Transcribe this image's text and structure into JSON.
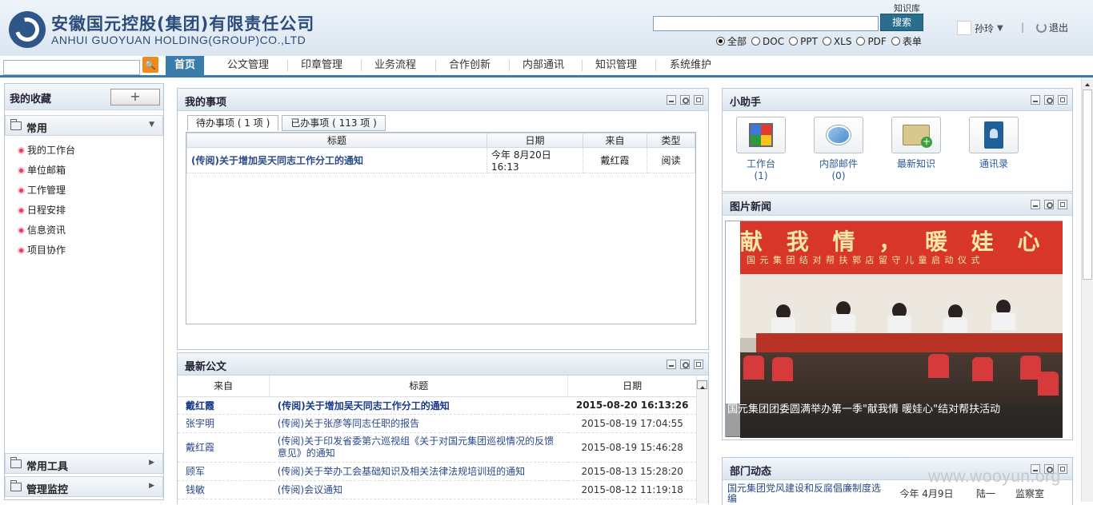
{
  "header": {
    "company_cn": "安徽国元控股(集团)有限责任公司",
    "company_en": "ANHUI GUOYUAN HOLDING(GROUP)CO.,LTD"
  },
  "knowledge": {
    "label": "知识库",
    "search_value": "",
    "search_button": "搜索",
    "filters": [
      {
        "label": "全部",
        "selected": true
      },
      {
        "label": "DOC",
        "selected": false
      },
      {
        "label": "PPT",
        "selected": false
      },
      {
        "label": "XLS",
        "selected": false
      },
      {
        "label": "PDF",
        "selected": false
      },
      {
        "label": "表单",
        "selected": false
      }
    ]
  },
  "user": {
    "name": "孙玲",
    "separator": "|",
    "logout": "退出"
  },
  "nav": {
    "items": [
      "首页",
      "公文管理",
      "印章管理",
      "业务流程",
      "合作创新",
      "内部通讯",
      "知识管理",
      "系统维护"
    ],
    "active_index": 0
  },
  "left": {
    "favorites_title": "我的收藏",
    "add_label": "+",
    "group_common": "常用",
    "items": [
      "我的工作台",
      "单位邮箱",
      "工作管理",
      "日程安排",
      "信息资讯",
      "项目协作"
    ],
    "group_tools": "常用工具",
    "group_monitor": "管理监控"
  },
  "matters": {
    "title": "我的事项",
    "tabs": [
      "待办事项 ( 1 项 )",
      "已办事项 ( 113 项 )"
    ],
    "columns": [
      "标题",
      "日期",
      "来自",
      "类型"
    ],
    "rows": [
      {
        "title": "(传阅)关于增加吴天同志工作分工的通知",
        "date": "今年  8月20日16:13",
        "from": "戴红霞",
        "type": "阅读"
      }
    ]
  },
  "documents": {
    "title": "最新公文",
    "columns": [
      "来自",
      "标题",
      "日期"
    ],
    "rows": [
      {
        "from": "戴红霞",
        "title": "(传阅)关于增加吴天同志工作分工的通知",
        "date": "2015-08-20 16:13:26",
        "bold": true
      },
      {
        "from": "张宇明",
        "title": "(传阅)关于张彦等同志任职的报告",
        "date": "2015-08-19 17:04:55",
        "bold": false
      },
      {
        "from": "戴红霞",
        "title": "(传阅)关于印发省委第六巡视组《关于对国元集团巡视情况的反馈意见》的通知",
        "date": "2015-08-19 15:46:28",
        "bold": false
      },
      {
        "from": "顾军",
        "title": "(传阅)关于举办工会基础知识及相关法律法规培训班的通知",
        "date": "2015-08-13 15:28:20",
        "bold": false
      },
      {
        "from": "钱敏",
        "title": "(传阅)会议通知",
        "date": "2015-08-12 11:19:18",
        "bold": false
      }
    ]
  },
  "helper": {
    "title": "小助手",
    "items": [
      {
        "label": "工作台",
        "count": "(1)",
        "icon": "workbench-icon"
      },
      {
        "label": "内部邮件",
        "count": "(0)",
        "icon": "mail-icon"
      },
      {
        "label": "最新知识",
        "count": "",
        "icon": "knowledge-folder-icon"
      },
      {
        "label": "通讯录",
        "count": "",
        "icon": "contacts-icon"
      }
    ]
  },
  "photo_news": {
    "title": "图片新闻",
    "banner": "献 我 情 ， 暖 娃 心 ”",
    "banner_sub": "国 元 集 团 结 对 帮 扶 郭 店 留 守 儿 童 启 动 仪 式",
    "caption": "国元集团团委圆满举办第一季\"献我情 暖娃心\"结对帮扶活动"
  },
  "dept": {
    "title": "部门动态",
    "row": {
      "title": "国元集团党风建设和反腐倡廉制度选编",
      "date": "今年  4月9日",
      "from": "陆一",
      "type": "监察室"
    }
  },
  "watermark": "www.wooyun.org",
  "colors": {
    "nav_active": "#3a7dab",
    "brand": "#2b4b7a",
    "search_button": "#2a6e8e",
    "left_search_button": "#f08a1c"
  }
}
